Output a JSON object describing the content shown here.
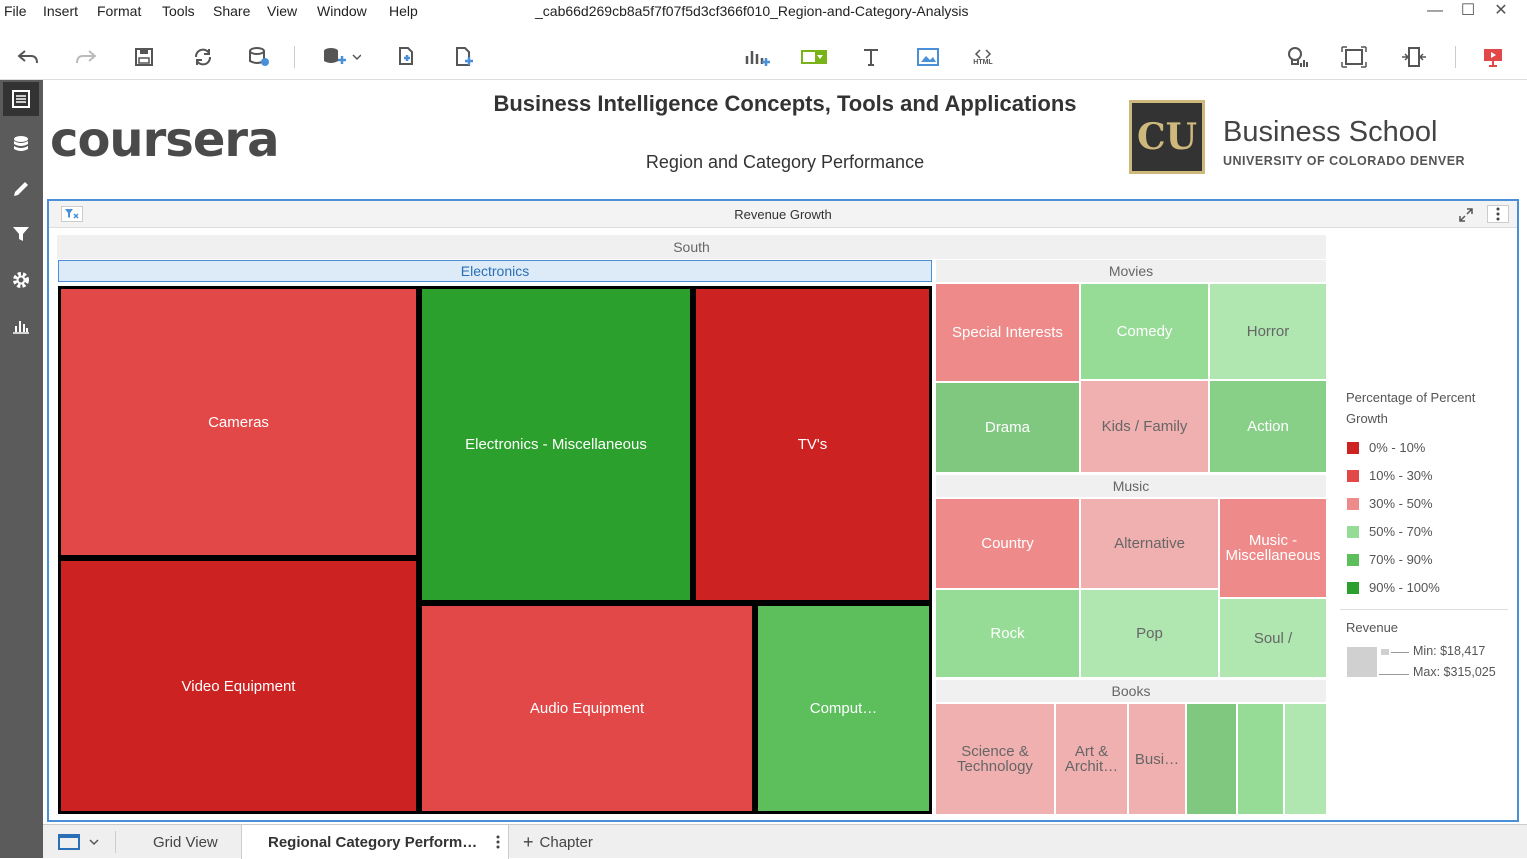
{
  "menubar": {
    "items": [
      "File",
      "Insert",
      "Format",
      "Tools",
      "Share",
      "View",
      "Window",
      "Help"
    ],
    "document_title": "_cab66d269cb8a5f7f07f5d3cf366f010_Region-and-Category-Analysis"
  },
  "window_controls": {
    "minimize": "—",
    "maximize": "☐",
    "close": "✕"
  },
  "header": {
    "title": "Business Intelligence Concepts, Tools and Applications",
    "subtitle": "Region and Category Performance",
    "coursera_logo": "coursera",
    "cu_logo_mark": "CU",
    "cu_business_school": "Business School",
    "cu_university": "UNIVERSITY OF COLORADO DENVER"
  },
  "toolbar": {
    "html_label": "HTML"
  },
  "panel": {
    "title": "Revenue Growth",
    "region": "South",
    "groups": {
      "electronics": "Electronics",
      "movies": "Movies",
      "music": "Music",
      "books": "Books"
    },
    "tiles": {
      "cameras": "Cameras",
      "video_equipment": "Video Equipment",
      "electronics_misc": "Electronics - Miscellaneous",
      "tvs": "TV's",
      "audio_equipment": "Audio Equipment",
      "computers": "Comput…",
      "special_interests": "Special Interests",
      "comedy": "Comedy",
      "horror": "Horror",
      "drama": "Drama",
      "kids_family": "Kids / Family",
      "action": "Action",
      "country": "Country",
      "alternative": "Alternative",
      "music_misc_1": "Music -",
      "music_misc_2": "Miscellaneous",
      "rock": "Rock",
      "pop": "Pop",
      "soul_rnb": "Soul /",
      "science_1": "Science &",
      "science_2": "Technology",
      "art_1": "Art &",
      "art_2": "Archit…",
      "business": "Busi…"
    }
  },
  "legend": {
    "color_title_1": "Percentage of Percent",
    "color_title_2": "Growth",
    "ranges": [
      {
        "label": "0% - 10%",
        "color": "#cc2222"
      },
      {
        "label": "10% - 30%",
        "color": "#e24848"
      },
      {
        "label": "30% - 50%",
        "color": "#ef8a8a"
      },
      {
        "label": "50% - 70%",
        "color": "#96dc96"
      },
      {
        "label": "70% - 90%",
        "color": "#5cbf5c"
      },
      {
        "label": "90% - 100%",
        "color": "#2ca02c"
      }
    ],
    "size_title": "Revenue",
    "min_label": "Min: $18,417",
    "max_label": "Max: $315,025"
  },
  "bottom_tabs": {
    "grid_view": "Grid View",
    "active": "Regional Category Perform…",
    "add_chapter": "Chapter",
    "add_symbol": "+"
  },
  "colors": {
    "dark_red": "#cc2222",
    "red": "#e24848",
    "pink": "#ef8a8a",
    "light_pink": "#f1b0b0",
    "green": "#2ca02c",
    "med_green": "#5cbf5c",
    "light_green": "#96dc96",
    "pale_green": "#b0e6b0",
    "accent_blue": "#4a90d9"
  }
}
